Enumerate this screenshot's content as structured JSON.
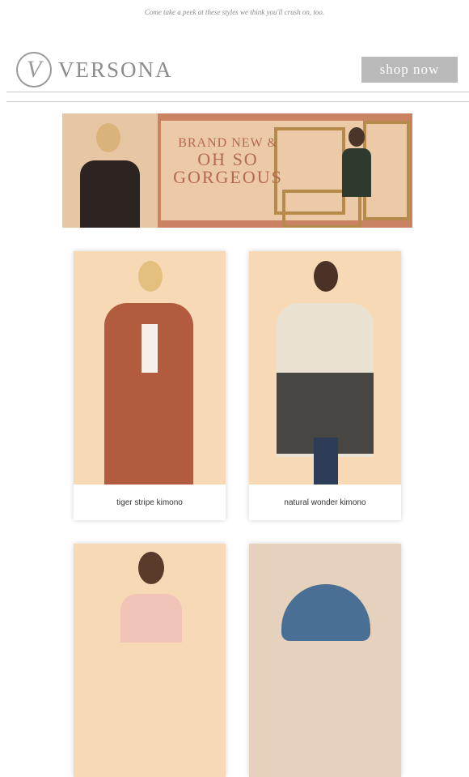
{
  "preheader": "Come take a peek at these styles we think you'll crush on, too.",
  "logo": {
    "monogram": "V",
    "brand": "VERSONA"
  },
  "header": {
    "shop_now": "shop now"
  },
  "banner": {
    "line1": "BRAND NEW &",
    "line2": "OH SO",
    "line3": "GORGEOUS"
  },
  "products": [
    {
      "label": "tiger stripe kimono"
    },
    {
      "label": "natural wonder kimono"
    },
    {
      "label": ""
    },
    {
      "label": ""
    }
  ],
  "colors": {
    "accent": "#b9b9b9",
    "banner_bg": "#c98262",
    "banner_text": "#b36a4f",
    "product_bg": "#f7d9b5"
  }
}
